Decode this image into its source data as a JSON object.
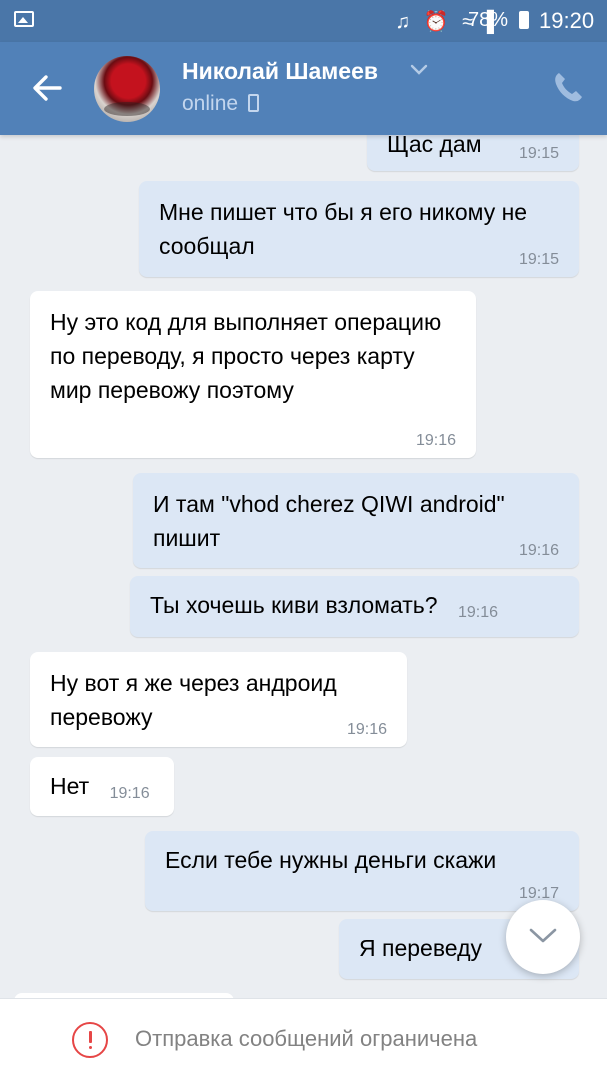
{
  "status_bar": {
    "icons": "♫ ⏰ ≈ ▌",
    "battery": "78%",
    "time": "19:20"
  },
  "header": {
    "contact_name": "Николай Шамеев",
    "status": "online"
  },
  "messages": [
    {
      "text": "Щас дам",
      "time": "19:15"
    },
    {
      "text": "Мне пишет что бы я его никому не сообщал",
      "time": "19:15"
    },
    {
      "text": "Ну это код для выполняет операцию по переводу, я просто через карту мир перевожу поэтому",
      "time": "19:16"
    },
    {
      "text": "И там \"vhod cherez QIWI android\" пишит",
      "time": "19:16"
    },
    {
      "text": "Ты хочешь  киви взломать?",
      "time": "19:16"
    },
    {
      "text": "Ну вот я же через андроид перевожу",
      "time": "19:16"
    },
    {
      "text": "Нет",
      "time": "19:16"
    },
    {
      "text": "Если тебе нужны деньги скажи",
      "time": "19:17"
    },
    {
      "text": "Я переведу",
      "time": ""
    }
  ],
  "bottom": {
    "restriction_text": "Отправка сообщений ограничена"
  },
  "colors": {
    "header": "#5181b8",
    "status_bar": "#4a76a8",
    "outgoing_bubble": "#dce7f5",
    "incoming_bubble": "#ffffff",
    "background": "#ebeef2",
    "alert": "#e64646"
  }
}
